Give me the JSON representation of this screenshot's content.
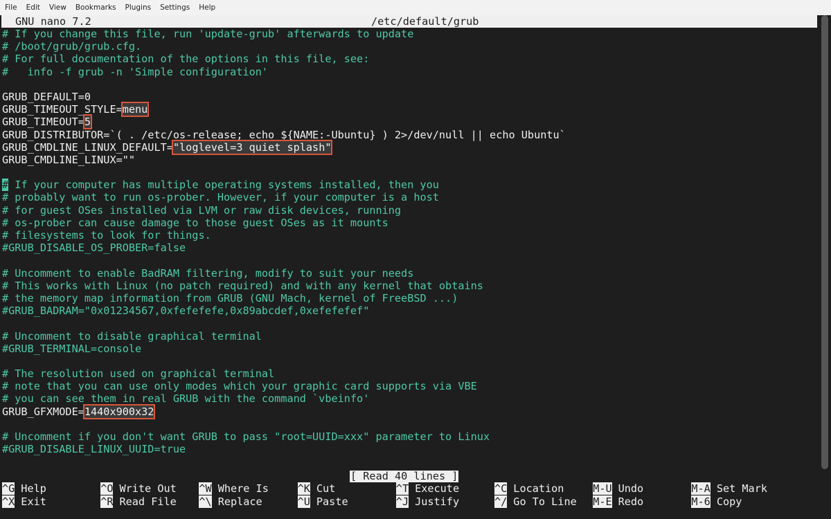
{
  "menubar": {
    "items": [
      "File",
      "Edit",
      "View",
      "Bookmarks",
      "Plugins",
      "Settings",
      "Help"
    ]
  },
  "nano": {
    "app_version": "GNU nano 7.2",
    "file_path": "/etc/default/grub",
    "status_message": "[ Read 40 lines ]"
  },
  "lines": [
    {
      "style": "comment",
      "text": "# If you change this file, run 'update-grub' afterwards to update"
    },
    {
      "style": "comment",
      "text": "# /boot/grub/grub.cfg."
    },
    {
      "style": "comment",
      "text": "# For full documentation of the options in this file, see:"
    },
    {
      "style": "comment",
      "text": "#   info -f grub -n 'Simple configuration'"
    },
    {
      "style": "normal",
      "text": ""
    },
    {
      "style": "normal",
      "text": "GRUB_DEFAULT=0"
    },
    {
      "style": "normal",
      "text": "GRUB_TIMEOUT_STYLE=",
      "value": "menu"
    },
    {
      "style": "normal",
      "text": "GRUB_TIMEOUT=",
      "value": "5"
    },
    {
      "style": "normal",
      "text": "GRUB_DISTRIBUTOR=`( . /etc/os-release; echo ${NAME:-Ubuntu} ) 2>/dev/null || echo Ubuntu`"
    },
    {
      "style": "normal",
      "text": "GRUB_CMDLINE_LINUX_DEFAULT=",
      "value": "\"loglevel=3 quiet splash\""
    },
    {
      "style": "normal",
      "text": "GRUB_CMDLINE_LINUX=\"\""
    },
    {
      "style": "normal",
      "text": ""
    },
    {
      "style": "comment",
      "cursor": "#",
      "text": " If your computer has multiple operating systems installed, then you"
    },
    {
      "style": "comment",
      "text": "# probably want to run os-prober. However, if your computer is a host"
    },
    {
      "style": "comment",
      "text": "# for guest OSes installed via LVM or raw disk devices, running"
    },
    {
      "style": "comment",
      "text": "# os-prober can cause damage to those guest OSes as it mounts"
    },
    {
      "style": "comment",
      "text": "# filesystems to look for things."
    },
    {
      "style": "comment",
      "text": "#GRUB_DISABLE_OS_PROBER=false"
    },
    {
      "style": "normal",
      "text": ""
    },
    {
      "style": "comment",
      "text": "# Uncomment to enable BadRAM filtering, modify to suit your needs"
    },
    {
      "style": "comment",
      "text": "# This works with Linux (no patch required) and with any kernel that obtains"
    },
    {
      "style": "comment",
      "text": "# the memory map information from GRUB (GNU Mach, kernel of FreeBSD ...)"
    },
    {
      "style": "comment",
      "text": "#GRUB_BADRAM=\"0x01234567,0xfefefefe,0x89abcdef,0xefefefef\""
    },
    {
      "style": "normal",
      "text": ""
    },
    {
      "style": "comment",
      "text": "# Uncomment to disable graphical terminal"
    },
    {
      "style": "comment",
      "text": "#GRUB_TERMINAL=console"
    },
    {
      "style": "normal",
      "text": ""
    },
    {
      "style": "comment",
      "text": "# The resolution used on graphical terminal"
    },
    {
      "style": "comment",
      "text": "# note that you can use only modes which your graphic card supports via VBE"
    },
    {
      "style": "comment",
      "text": "# you can see them in real GRUB with the command `vbeinfo'"
    },
    {
      "style": "normal",
      "text": "GRUB_GFXMODE=",
      "value": "1440x900x32"
    },
    {
      "style": "normal",
      "text": ""
    },
    {
      "style": "comment",
      "text": "# Uncomment if you don't want GRUB to pass \"root=UUID=xxx\" parameter to Linux"
    },
    {
      "style": "comment",
      "text": "#GRUB_DISABLE_LINUX_UUID=true"
    }
  ],
  "shortcuts": [
    {
      "key": "^G",
      "label": "Help"
    },
    {
      "key": "^X",
      "label": "Exit"
    },
    {
      "key": "^O",
      "label": "Write Out"
    },
    {
      "key": "^R",
      "label": "Read File"
    },
    {
      "key": "^W",
      "label": "Where Is"
    },
    {
      "key": "^\\",
      "label": "Replace"
    },
    {
      "key": "^K",
      "label": "Cut"
    },
    {
      "key": "^U",
      "label": "Paste"
    },
    {
      "key": "^T",
      "label": "Execute"
    },
    {
      "key": "^J",
      "label": "Justify"
    },
    {
      "key": "^C",
      "label": "Location"
    },
    {
      "key": "^/",
      "label": "Go To Line"
    },
    {
      "key": "M-U",
      "label": "Undo"
    },
    {
      "key": "M-E",
      "label": "Redo"
    },
    {
      "key": "M-A",
      "label": "Set Mark"
    },
    {
      "key": "M-6",
      "label": "Copy"
    }
  ],
  "colors": {
    "background": "#1e1e1e",
    "comment": "#4ec9a7",
    "highlight_outline": "#d9563a",
    "bar": "#efefef"
  }
}
